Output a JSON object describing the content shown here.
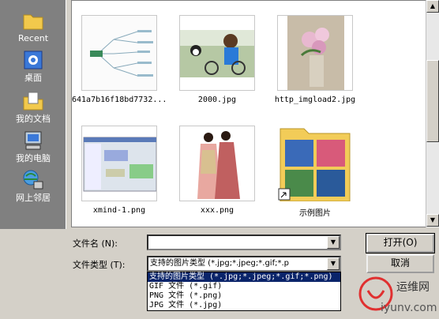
{
  "places": [
    {
      "label": "Recent",
      "icon": "folder-recent-icon"
    },
    {
      "label": "桌面",
      "icon": "desktop-icon"
    },
    {
      "label": "我的文档",
      "icon": "my-documents-icon"
    },
    {
      "label": "我的电脑",
      "icon": "my-computer-icon"
    },
    {
      "label": "网上邻居",
      "icon": "network-icon"
    }
  ],
  "files": [
    {
      "name": "641a7b16f18bd7732...",
      "kind": "mindmap-image"
    },
    {
      "name": "2000.jpg",
      "kind": "photo-boy-bike"
    },
    {
      "name": "http_imgload2.jpg",
      "kind": "photo-flowers"
    },
    {
      "name": "xmind-1.png",
      "kind": "screenshot"
    },
    {
      "name": "xxx.png",
      "kind": "costume-illustration"
    },
    {
      "name": "示例图片",
      "kind": "folder"
    }
  ],
  "form": {
    "filename_label": "文件名 (N):",
    "filename_value": "",
    "filetype_label": "文件类型 (T):",
    "filetype_value": "支持的图片类型 (*.jpg;*.jpeg;*.gif;*.p",
    "open_label": "打开(O)",
    "cancel_label": "取消"
  },
  "filetype_options": [
    "支持的图片类型 (*.jpg;*.jpeg;*.gif;*.png)",
    "GIF 文件 (*.gif)",
    "PNG 文件 (*.png)",
    "JPG 文件 (*.jpg)"
  ],
  "watermark": {
    "line1": "运维网",
    "line2": "iyunv.com"
  },
  "colors": {
    "selection": "#0a246a",
    "panel": "#d4d0c8",
    "places_bg": "#808080"
  }
}
